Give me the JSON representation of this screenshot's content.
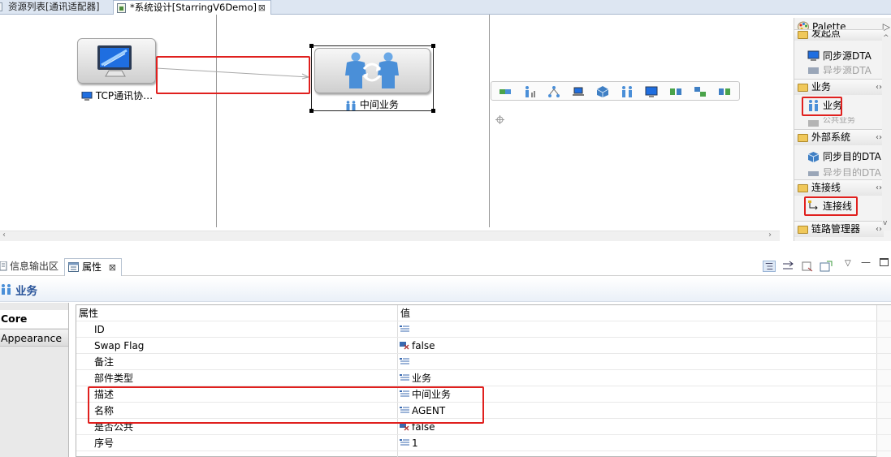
{
  "editor_tabs": {
    "inactive_label": "资源列表[通讯适配器]",
    "active_label": "*系统设计[StarringV6Demo]",
    "close_glyph": "⊠"
  },
  "canvas": {
    "source_node_label": "TCP通讯协…",
    "target_node_label": "中间业务",
    "source_icon": "monitor-icon",
    "target_icon": "people-exchange-icon"
  },
  "palette": {
    "title": "Palette",
    "drawers": [
      {
        "label": "发起点",
        "items": [
          "同步源DTA",
          "异步源DTA"
        ]
      },
      {
        "label": "业务",
        "items": [
          "业务",
          "公共业务"
        ]
      },
      {
        "label": "外部系统",
        "items": [
          "同步目的DTA",
          "异步目的DTA"
        ]
      },
      {
        "label": "连接线",
        "items": [
          "连接线"
        ]
      },
      {
        "label": "链路管理器",
        "items": []
      }
    ]
  },
  "bottom_tabs": {
    "info_label": "信息输出区",
    "props_label": "属性"
  },
  "properties": {
    "title": "业务",
    "categories": [
      "Core",
      "Appearance"
    ],
    "header": {
      "name": "属性",
      "value": "值"
    },
    "rows": [
      {
        "name": "ID",
        "value": ""
      },
      {
        "name": "Swap Flag",
        "value": "false"
      },
      {
        "name": "备注",
        "value": ""
      },
      {
        "name": "部件类型",
        "value": "业务"
      },
      {
        "name": "描述",
        "value": "中间业务"
      },
      {
        "name": "名称",
        "value": "AGENT"
      },
      {
        "name": "是否公共",
        "value": "false"
      },
      {
        "name": "序号",
        "value": "1"
      }
    ]
  },
  "colors": {
    "highlight_red": "#e0201e",
    "title_blue": "#29549a",
    "tab_bar_blue": "#dde6f2"
  }
}
